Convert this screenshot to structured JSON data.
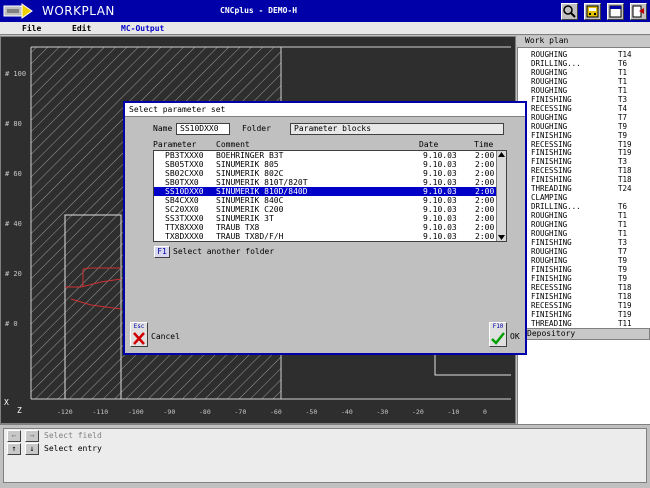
{
  "app": {
    "name": "WORKPLAN",
    "title": "CNCplus - DEMO-H"
  },
  "menu": [
    "File",
    "Edit",
    "MC-Output"
  ],
  "graphic": {
    "y_ticks": [
      "100",
      "80",
      "60",
      "40",
      "20",
      "0"
    ],
    "x_ticks": [
      "-120",
      "-110",
      "-100",
      "-90",
      "-80",
      "-70",
      "-60",
      "-50",
      "-40",
      "-30",
      "-20",
      "-10",
      "0"
    ],
    "y_axis_symbol": "X",
    "x_axis_symbol": "Z"
  },
  "worklist": {
    "header": "Work plan",
    "items": [
      {
        "name": "ROUGHING",
        "tool": "T14"
      },
      {
        "name": "DRILLING...",
        "tool": "T6"
      },
      {
        "name": "ROUGHING",
        "tool": "T1"
      },
      {
        "name": "ROUGHING",
        "tool": "T1"
      },
      {
        "name": "ROUGHING",
        "tool": "T1"
      },
      {
        "name": "FINISHING",
        "tool": "T3"
      },
      {
        "name": "RECESSING",
        "tool": "T4"
      },
      {
        "name": "ROUGHING",
        "tool": "T7"
      },
      {
        "name": "ROUGHING",
        "tool": "T9"
      },
      {
        "name": "FINISHING",
        "tool": "T9"
      },
      {
        "name": "RECESSING",
        "tool": "T19"
      },
      {
        "name": "FINISHING",
        "tool": "T19"
      },
      {
        "name": "FINISHING",
        "tool": "T3"
      },
      {
        "name": "RECESSING",
        "tool": "T18"
      },
      {
        "name": "FINISHING",
        "tool": "T18"
      },
      {
        "name": "THREADING",
        "tool": "T24"
      },
      {
        "name": "CLAMPING",
        "tool": ""
      },
      {
        "name": "DRILLING...",
        "tool": "T6"
      },
      {
        "name": "ROUGHING",
        "tool": "T1"
      },
      {
        "name": "ROUGHING",
        "tool": "T1"
      },
      {
        "name": "ROUGHING",
        "tool": "T1"
      },
      {
        "name": "FINISHING",
        "tool": "T3"
      },
      {
        "name": "ROUGHING",
        "tool": "T7"
      },
      {
        "name": "ROUGHING",
        "tool": "T9"
      },
      {
        "name": "FINISHING",
        "tool": "T9"
      },
      {
        "name": "FINISHING",
        "tool": "T9"
      },
      {
        "name": "RECESSING",
        "tool": "T18"
      },
      {
        "name": "FINISHING",
        "tool": "T18"
      },
      {
        "name": "RECESSING",
        "tool": "T19"
      },
      {
        "name": "FINISHING",
        "tool": "T19"
      },
      {
        "name": "THREADING",
        "tool": "T11"
      }
    ],
    "depository_header": "Depository"
  },
  "dialog": {
    "title": "Select parameter set",
    "name_label": "Name",
    "name_value": "SS10DXX0",
    "folder_label": "Folder",
    "folder_value": "Parameter blocks",
    "columns": {
      "parameter": "Parameter",
      "comment": "Comment",
      "date": "Date",
      "time": "Time"
    },
    "rows": [
      {
        "param": "PB3TXXX0",
        "comment": "BOEHRINGER B3T",
        "date": "9.10.03",
        "time": "2:00"
      },
      {
        "param": "SB05TXX0",
        "comment": "SINUMERIK 805",
        "date": "9.10.03",
        "time": "2:00"
      },
      {
        "param": "SB02CXX0",
        "comment": "SINUMERIK 802C",
        "date": "9.10.03",
        "time": "2:00"
      },
      {
        "param": "SB0TXX0",
        "comment": "SINUMERIK 810T/820T",
        "date": "9.10.03",
        "time": "2:00"
      },
      {
        "param": "SS10DXX0",
        "comment": "SINUMERIK 810D/840D",
        "date": "9.10.03",
        "time": "2:00"
      },
      {
        "param": "SB4CXX0",
        "comment": "SINUMERIK 840C",
        "date": "9.10.03",
        "time": "2:00"
      },
      {
        "param": "SC20XX0",
        "comment": "SINUMERIK C200",
        "date": "9.10.03",
        "time": "2:00"
      },
      {
        "param": "SS3TXXX0",
        "comment": "SINUMERIK 3T",
        "date": "9.10.03",
        "time": "2:00"
      },
      {
        "param": "TTX8XXX0",
        "comment": "TRAUB TX8",
        "date": "9.10.03",
        "time": "2:00"
      },
      {
        "param": "TX8DXXX0",
        "comment": "TRAUB TX8D/F/H",
        "date": "9.10.03",
        "time": "2:00"
      }
    ],
    "selected_index": 4,
    "f1_key": "F1",
    "select_folder_label": "Select another folder",
    "esc_key": "Esc",
    "cancel_label": "Cancel",
    "f10_key": "F10",
    "ok_label": "OK"
  },
  "status": {
    "line1": "Select field",
    "line2": "Select entry"
  },
  "colors": {
    "title_bg": "#0000a8",
    "selection": "#0000c8",
    "contour": "#d03030",
    "graphic_bg": "#2e2e2e"
  }
}
